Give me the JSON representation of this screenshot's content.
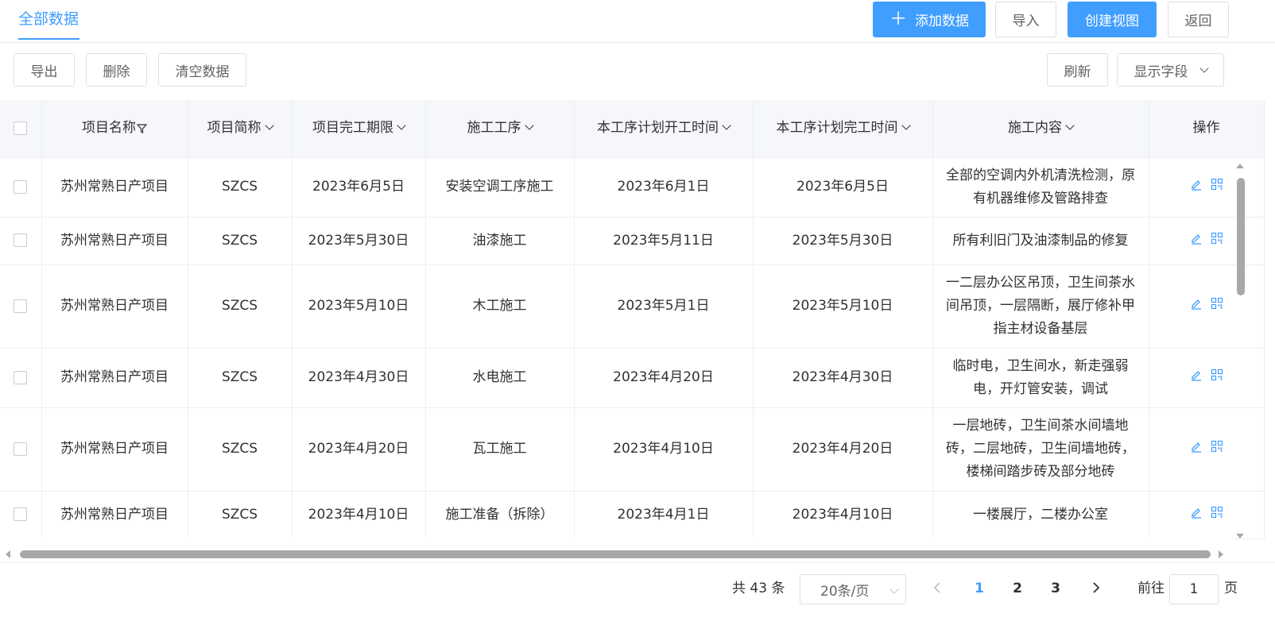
{
  "header": {
    "tab_label": "全部数据",
    "buttons": {
      "add": "添加数据",
      "import": "导入",
      "create_view": "创建视图",
      "back": "返回"
    }
  },
  "toolbar": {
    "export": "导出",
    "delete": "删除",
    "clear": "清空数据",
    "refresh": "刷新",
    "fields": "显示字段"
  },
  "table": {
    "columns": [
      "项目名称",
      "项目简称",
      "项目完工期限",
      "施工工序",
      "本工序计划开工时间",
      "本工序计划完工时间",
      "施工内容",
      "操作"
    ],
    "rows": [
      {
        "name": "苏州常熟日产项目",
        "short": "SZCS",
        "deadline": "2023年6月5日",
        "process": "安装空调工序施工",
        "start": "2023年6月1日",
        "end": "2023年6月5日",
        "content": "全部的空调内外机清洗检测，原有机器维修及管路排查"
      },
      {
        "name": "苏州常熟日产项目",
        "short": "SZCS",
        "deadline": "2023年5月30日",
        "process": "油漆施工",
        "start": "2023年5月11日",
        "end": "2023年5月30日",
        "content": "所有利旧门及油漆制品的修复"
      },
      {
        "name": "苏州常熟日产项目",
        "short": "SZCS",
        "deadline": "2023年5月10日",
        "process": "木工施工",
        "start": "2023年5月1日",
        "end": "2023年5月10日",
        "content": "一二层办公区吊顶，卫生间茶水间吊顶，一层隔断，展厅修补甲指主材设备基层"
      },
      {
        "name": "苏州常熟日产项目",
        "short": "SZCS",
        "deadline": "2023年4月30日",
        "process": "水电施工",
        "start": "2023年4月20日",
        "end": "2023年4月30日",
        "content": "临时电，卫生间水，新走强弱电，开灯管安装，调试"
      },
      {
        "name": "苏州常熟日产项目",
        "short": "SZCS",
        "deadline": "2023年4月20日",
        "process": "瓦工施工",
        "start": "2023年4月10日",
        "end": "2023年4月20日",
        "content": "一层地砖，卫生间茶水间墙地砖，二层地砖，卫生间墙地砖，楼梯间踏步砖及部分地砖"
      },
      {
        "name": "苏州常熟日产项目",
        "short": "SZCS",
        "deadline": "2023年4月10日",
        "process": "施工准备（拆除）",
        "start": "2023年4月1日",
        "end": "2023年4月10日",
        "content": "一楼展厅，二楼办公室"
      }
    ]
  },
  "pagination": {
    "total_text": "共 43 条",
    "page_size": "20条/页",
    "pages": [
      "1",
      "2",
      "3"
    ],
    "current_page": "1",
    "goto_label": "前往",
    "goto_value": "1",
    "page_suffix": "页"
  },
  "colors": {
    "primary": "#409eff",
    "border": "#ebeef5",
    "header_bg": "#f5f7fa"
  },
  "icons": [
    "plus-icon",
    "chevron-down-icon",
    "filter-icon",
    "edit-icon",
    "qrcode-icon",
    "chevron-left-icon",
    "chevron-right-icon"
  ]
}
